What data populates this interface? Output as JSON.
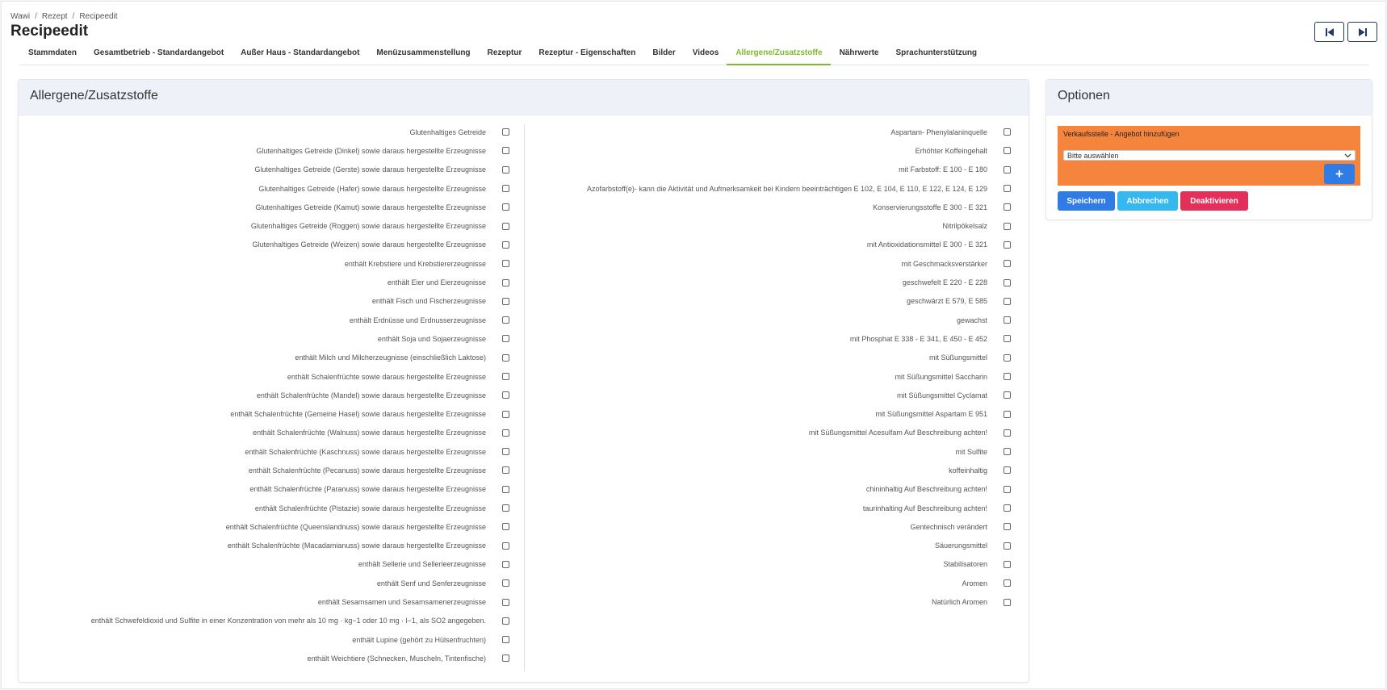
{
  "breadcrumb": [
    "Wawi",
    "Rezept",
    "Recipeedit"
  ],
  "page_title": "Recipeedit",
  "tabs": [
    {
      "label": "Stammdaten",
      "active": false
    },
    {
      "label": "Gesamtbetrieb - Standardangebot",
      "active": false
    },
    {
      "label": "Außer Haus - Standardangebot",
      "active": false
    },
    {
      "label": "Menüzusammenstellung",
      "active": false
    },
    {
      "label": "Rezeptur",
      "active": false
    },
    {
      "label": "Rezeptur - Eigenschaften",
      "active": false
    },
    {
      "label": "Bilder",
      "active": false
    },
    {
      "label": "Videos",
      "active": false
    },
    {
      "label": "Allergene/Zusatzstoffe",
      "active": true
    },
    {
      "label": "Nährwerte",
      "active": false
    },
    {
      "label": "Sprachunterstützung",
      "active": false
    }
  ],
  "allergen_card": {
    "title": "Allergene/Zusatzstoffe",
    "left_items": [
      "Glutenhaltiges Getreide",
      "Glutenhaltiges Getreide (Dinkel) sowie daraus hergestellte Erzeugnisse",
      "Glutenhaltiges Getreide (Gerste) sowie daraus hergestellte Erzeugnisse",
      "Glutenhaltiges Getreide (Hafer) sowie daraus hergestellte Erzeugnisse",
      "Glutenhaltiges Getreide (Kamut) sowie daraus hergestellte Erzeugnisse",
      "Glutenhaltiges Getreide (Roggen) sowie daraus hergestellte Erzeugnisse",
      "Glutenhaltiges Getreide (Weizen) sowie daraus hergestellte Erzeugnisse",
      "enthält Krebstiere und Krebstiererzeugnisse",
      "enthält Eier und Eierzeugnisse",
      "enthält Fisch und Fischerzeugnisse",
      "enthält Erdnüsse und Erdnusserzeugnisse",
      "enthält Soja und Sojaerzeugnisse",
      "enthält Milch und Milcherzeugnisse (einschließlich Laktose)",
      "enthält Schalenfrüchte sowie daraus hergestellte Erzeugnisse",
      "enthält Schalenfrüchte (Mandel) sowie daraus hergestellte Erzeugnisse",
      "enthält Schalenfrüchte (Gemeine Hasel) sowie daraus hergestellte Erzeugnisse",
      "enthält Schalenfrüchte (Walnuss) sowie daraus hergestellte Erzeugnisse",
      "enthält Schalenfrüchte (Kaschnuss) sowie daraus hergestellte Erzeugnisse",
      "enthält Schalenfrüchte (Pecanuss) sowie daraus hergestellte Erzeugnisse",
      "enthält Schalenfrüchte (Paranuss) sowie daraus hergestellte Erzeugnisse",
      "enthält Schalenfrüchte (Pistazie) sowie daraus hergestellte Erzeugnisse",
      "enthält Schalenfrüchte (Queenslandnuss) sowie daraus hergestellte Erzeugnisse",
      "enthält Schalenfrüchte (Macadamianuss) sowie daraus hergestellte Erzeugnisse",
      "enthält Sellerie und Sellerieerzeugnisse",
      "enthält Senf und Senferzeugnisse",
      "enthält Sesamsamen und Sesamsamenerzeugnisse",
      "enthält Schwefeldioxid und Sulfite in einer Konzentration von mehr als 10 mg · kg−1 oder 10 mg · l−1, als SO2 angegeben.",
      "enthält Lupine (gehört zu Hülsenfruchten)",
      "enthält Weichtiere (Schnecken, Muscheln, Tintenfische)"
    ],
    "right_items": [
      "Aspartam- Phenylalaninquelle",
      "Erhöhter Koffeingehalt",
      "mit Farbstoff: E 100 - E 180",
      "Azofarbstoff(e)- kann die Aktivität und Aufmerksamkeit bei Kindern beeinträchtigen E 102, E 104, E 110, E 122, E 124, E 129",
      "Konservierungsstoffe E 300 - E 321",
      "Nitrilpökelsalz",
      "mit Antioxidationsmittel E 300 - E 321",
      "mit Geschmacksverstärker",
      "geschwefelt E 220 - E 228",
      "geschwärzt E 579, E 585",
      "gewachst",
      "mit Phosphat E 338 - E 341, E 450 - E 452",
      "mit Süßungsmittel",
      "mit Süßungsmittel Saccharin",
      "mit Süßungsmittel Cyclamat",
      "mit Süßungsmittel Aspartam E 951",
      "mit Süßungsmittel Acesulfam Auf Beschreibung achten!",
      "mit Sulfite",
      "koffeinhaltig",
      "chininhaltig Auf Beschreibung achten!",
      "taurinhalting Auf Beschreibung achten!",
      "Gentechnisch verändert",
      "Säuerungsmittel",
      "Stabilisatoren",
      "Aromen",
      "Natürlich Aromen"
    ]
  },
  "options_card": {
    "title": "Optionen",
    "sales_point_label": "Verkaufsstelle - Angebot hinzufügen",
    "select_value": "Bitte auswählen",
    "add_label": "+",
    "save_label": "Speichern",
    "cancel_label": "Abbrechen",
    "deactivate_label": "Deaktivieren"
  },
  "colors": {
    "accent_tab": "#7dba2f",
    "orange_panel": "#f5843d",
    "primary": "#2f7ce6",
    "info": "#35b8f0",
    "danger": "#e2305a"
  }
}
